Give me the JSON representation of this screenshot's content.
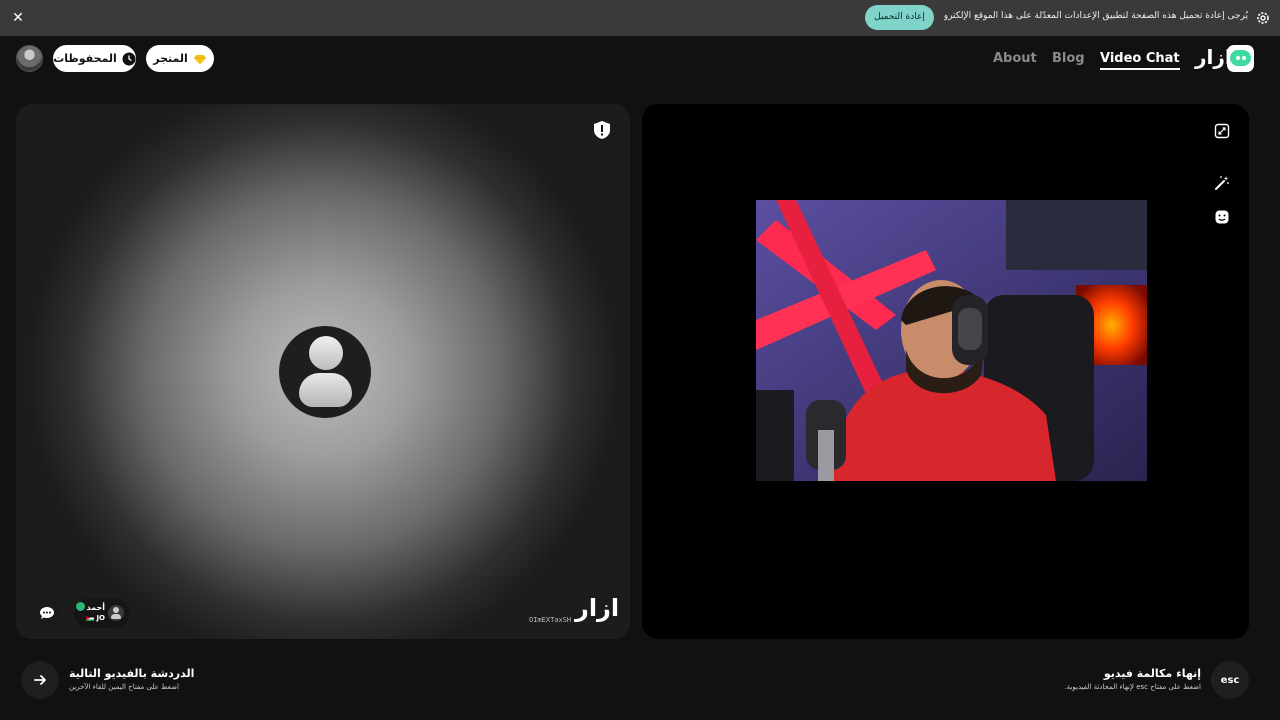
{
  "banner": {
    "message": "يُرجى إعادة تحميل هذه الصفحة لتطبيق الإعدادات المعدَّلة على هذا الموقع الإلكتروني.",
    "reload_label": "إعادة التحميل",
    "close_icon": "close-icon",
    "settings_icon": "gear-icon"
  },
  "header": {
    "saved_label": "المحفوظات",
    "store_label": "المتجر",
    "nav": {
      "about": "About",
      "blog": "Blog",
      "video_chat": "Video Chat"
    },
    "logo_text": "ازار",
    "accent": "#7fd3c8"
  },
  "left_panel": {
    "partner": {
      "name": "أحمد",
      "country": "JO"
    },
    "watermark_id": "OImEXTaxSH",
    "watermark_logo": "ازار"
  },
  "bottom": {
    "next_title": "الدردشة بالفيديو التالية",
    "next_sub": "اضغط على مفتاح اليمين للقاء الآخرين",
    "end_button": "esc",
    "end_title": "إنهاء مكالمة فيديو",
    "end_sub": "اضغط على مفتاح esc لإنهاء المحادثة الفيديوية."
  }
}
